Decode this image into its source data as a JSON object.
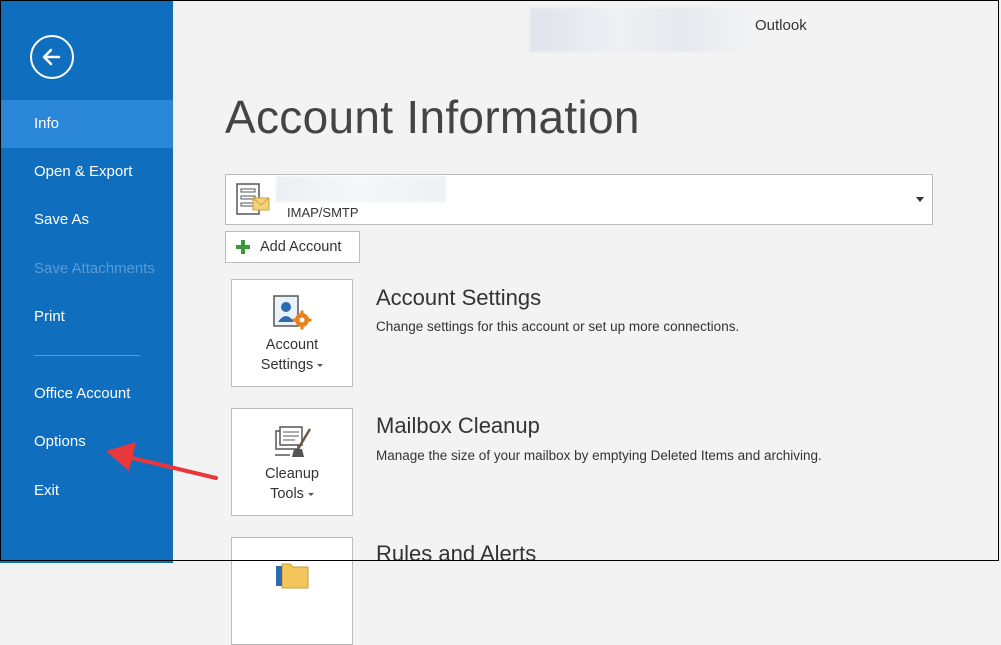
{
  "window": {
    "app_name": "Outlook"
  },
  "sidebar": {
    "items": [
      {
        "label": "Info",
        "active": true
      },
      {
        "label": "Open & Export"
      },
      {
        "label": "Save As"
      },
      {
        "label": "Save Attachments",
        "disabled": true
      },
      {
        "label": "Print"
      },
      {
        "label": "Office Account"
      },
      {
        "label": "Options"
      },
      {
        "label": "Exit"
      }
    ]
  },
  "main": {
    "title": "Account Information",
    "account": {
      "type": "IMAP/SMTP"
    },
    "add_account_label": "Add Account",
    "sections": [
      {
        "tile_line1": "Account",
        "tile_line2": "Settings",
        "title": "Account Settings",
        "description": "Change settings for this account or set up more connections."
      },
      {
        "tile_line1": "Cleanup",
        "tile_line2": "Tools",
        "title": "Mailbox Cleanup",
        "description": "Manage the size of your mailbox by emptying Deleted Items and archiving."
      },
      {
        "title": "Rules and Alerts"
      }
    ]
  },
  "colors": {
    "sidebar": "#106ebe",
    "sidebar_active": "#2b88d8",
    "annotation_arrow": "#e8383b"
  },
  "icons": [
    "back-arrow-icon",
    "account-card-icon",
    "plus-icon",
    "account-settings-icon",
    "cleanup-tools-icon",
    "rules-folder-icon"
  ]
}
